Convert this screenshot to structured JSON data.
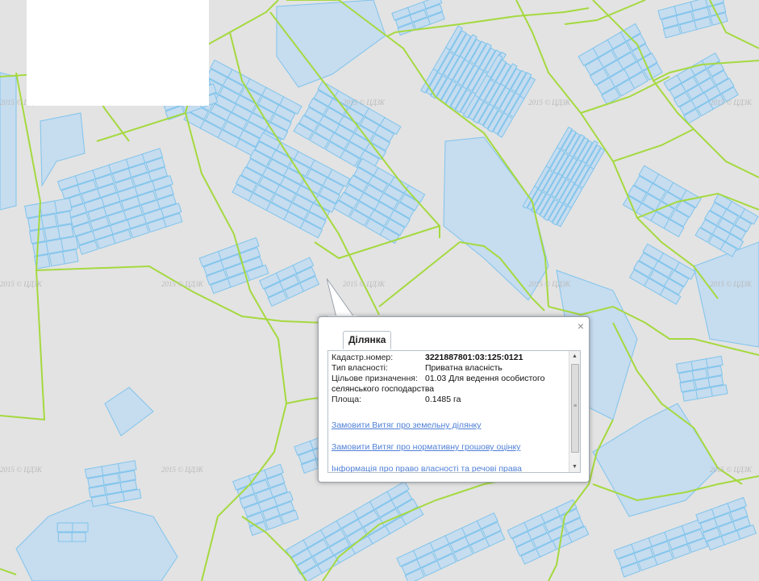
{
  "map": {
    "colors": {
      "background": "#e3e3e3",
      "parcel_fill": "#c6dcef",
      "parcel_stroke": "#7fc4ec",
      "boundary_line": "#9fd63a"
    },
    "watermark_text": "2015 © ЦДЗК"
  },
  "popup": {
    "tab_label": "Ділянка",
    "close_icon": "×",
    "fields": [
      {
        "label": "Кадастр.номер:",
        "value": "3221887801:03:125:0121"
      },
      {
        "label": "Тип власності:",
        "value": "Приватна власність"
      },
      {
        "label": "Цільове призначення:",
        "value": "01.03 Для ведення особистого"
      },
      {
        "label": "",
        "value": "селянського господарства"
      },
      {
        "label": "Площа:",
        "value": "0.1485 га"
      }
    ],
    "links": [
      "Замовити Витяг про земельну ділянку",
      "Замовити Витяг про нормативну грошову оцінку",
      "Інформація про право власності та речові права"
    ]
  }
}
